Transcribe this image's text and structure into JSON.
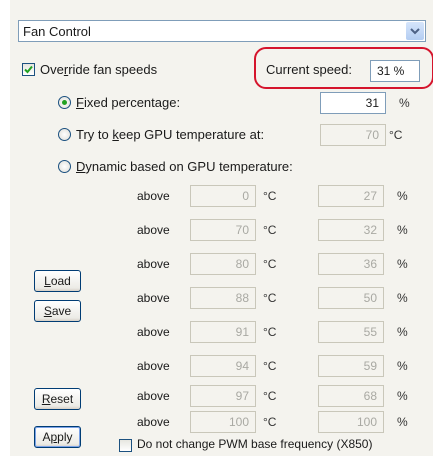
{
  "fan_control": {
    "dropdown_value": "Fan Control",
    "override_label_pre": "Ove",
    "override_label_u": "r",
    "override_label_post": "ride fan speeds",
    "current_speed_label": "Current speed:",
    "current_speed_value": "31 %",
    "fixed_pre": "",
    "fixed_u": "F",
    "fixed_post": "ixed percentage:",
    "fixed_value": "31",
    "fixed_unit": "%",
    "keep_pre": "Try to ",
    "keep_u": "k",
    "keep_post": "eep GPU temperature at:",
    "keep_value": "70",
    "keep_unit": "°C",
    "dynamic_pre": "",
    "dynamic_u": "D",
    "dynamic_post": "ynamic based on GPU temperature:",
    "rows": [
      {
        "label": "above",
        "temp": "0",
        "temp_unit": "°C",
        "speed": "27",
        "speed_unit": "%"
      },
      {
        "label": "above",
        "temp": "70",
        "temp_unit": "°C",
        "speed": "32",
        "speed_unit": "%"
      },
      {
        "label": "above",
        "temp": "80",
        "temp_unit": "°C",
        "speed": "36",
        "speed_unit": "%"
      },
      {
        "label": "above",
        "temp": "88",
        "temp_unit": "°C",
        "speed": "50",
        "speed_unit": "%"
      },
      {
        "label": "above",
        "temp": "91",
        "temp_unit": "°C",
        "speed": "55",
        "speed_unit": "%"
      },
      {
        "label": "above",
        "temp": "94",
        "temp_unit": "°C",
        "speed": "59",
        "speed_unit": "%"
      },
      {
        "label": "above",
        "temp": "97",
        "temp_unit": "°C",
        "speed": "68",
        "speed_unit": "%"
      },
      {
        "label": "above",
        "temp": "100",
        "temp_unit": "°C",
        "speed": "100",
        "speed_unit": "%"
      }
    ],
    "load_label_u": "L",
    "load_label_post": "oad",
    "save_label_u": "S",
    "save_label_post": "ave",
    "reset_label_u": "R",
    "reset_label_post": "eset",
    "apply_label_pre": "A",
    "apply_label_u": "p",
    "apply_label_post": "ply",
    "pwm_label": "Do not change PWM base frequency (X850)"
  },
  "colors": {
    "highlight": "#d5142c",
    "check": "#21a121"
  },
  "icons": {
    "dropdown": "chevron-down-icon",
    "checkmark": "checkmark-icon"
  }
}
